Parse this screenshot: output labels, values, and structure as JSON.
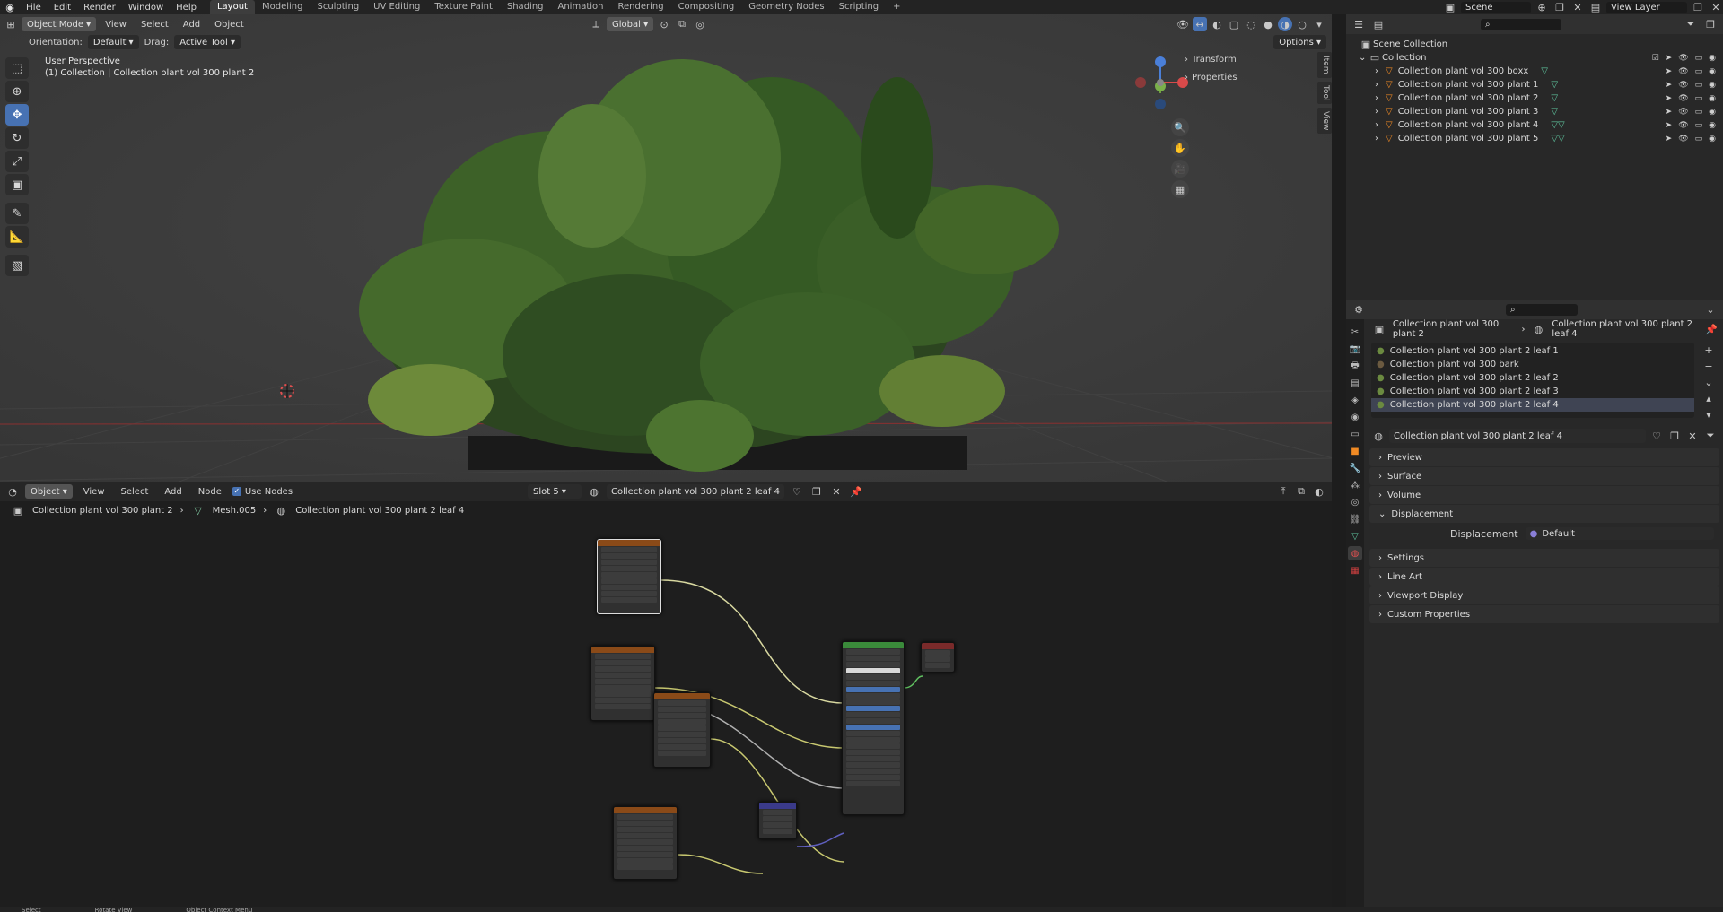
{
  "topbar": {
    "menus": [
      "File",
      "Edit",
      "Render",
      "Window",
      "Help"
    ],
    "workspaces": [
      "Layout",
      "Modeling",
      "Sculpting",
      "UV Editing",
      "Texture Paint",
      "Shading",
      "Animation",
      "Rendering",
      "Compositing",
      "Geometry Nodes",
      "Scripting"
    ],
    "active_workspace": "Layout",
    "scene": "Scene",
    "view_layer": "View Layer"
  },
  "viewport": {
    "mode": "Object Mode",
    "menu": [
      "View",
      "Select",
      "Add",
      "Object"
    ],
    "transform_orientation": "Global",
    "orientation_label": "Orientation:",
    "orientation_value": "Default",
    "drag_label": "Drag:",
    "drag_value": "Active Tool",
    "options": "Options",
    "perspective": "User Perspective",
    "context": "(1) Collection | Collection plant vol 300 plant 2",
    "npanel": [
      "Transform",
      "Properties"
    ],
    "side_tabs": [
      "Item",
      "Tool",
      "View"
    ]
  },
  "node_editor": {
    "editor_type": "Object",
    "menu": [
      "View",
      "Select",
      "Add",
      "Node"
    ],
    "use_nodes_label": "Use Nodes",
    "slot": "Slot 5",
    "material": "Collection plant vol 300 plant 2 leaf 4",
    "breadcrumb": [
      "Collection plant vol 300 plant 2",
      "Mesh.005",
      "Collection plant vol 300 plant 2 leaf 4"
    ]
  },
  "outliner": {
    "root": "Scene Collection",
    "collection": "Collection",
    "items": [
      "Collection plant vol 300 boxx",
      "Collection plant vol 300 plant 1",
      "Collection plant vol 300 plant 2",
      "Collection plant vol 300 plant 3",
      "Collection plant vol 300 plant 4",
      "Collection plant vol 300 plant 5"
    ]
  },
  "properties": {
    "breadcrumb_object": "Collection plant vol 300 plant 2",
    "breadcrumb_material": "Collection plant vol 300 plant 2 leaf 4",
    "slots": [
      "Collection plant vol 300 plant 2 leaf 1",
      "Collection plant vol 300 bark",
      "Collection plant vol 300 plant 2 leaf 2",
      "Collection plant vol 300 plant 2 leaf 3",
      "Collection plant vol 300 plant 2 leaf 4"
    ],
    "selected_slot": 4,
    "material_name": "Collection plant vol 300 plant 2 leaf 4",
    "panels": [
      "Preview",
      "Surface",
      "Volume",
      "Displacement",
      "Settings",
      "Line Art",
      "Viewport Display",
      "Custom Properties"
    ],
    "displacement_label": "Displacement",
    "displacement_value": "Default"
  },
  "status": [
    "Select",
    "Rotate View",
    "Object Context Menu"
  ],
  "colors": {
    "accent": "#4772b3",
    "texture_node": "#8a4a18",
    "bsdf_node": "#3a8a3a",
    "output_node": "#7a2a2a",
    "normal_node": "#3a3a8a"
  }
}
